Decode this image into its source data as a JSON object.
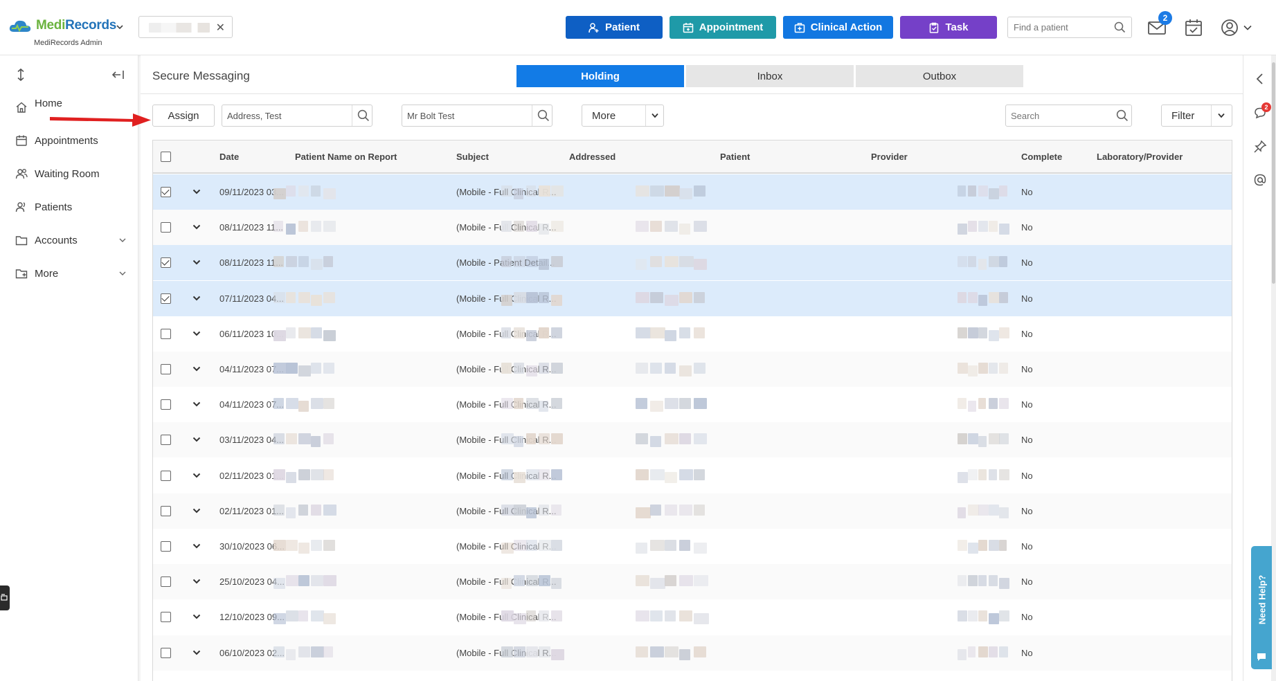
{
  "header": {
    "logo_part1": "Medi",
    "logo_part2": "Records",
    "subtitle": "MediRecords Admin",
    "buttons": [
      {
        "label": "Patient",
        "color": "#0e5fc4"
      },
      {
        "label": "Appointment",
        "color": "#1f9aa8"
      },
      {
        "label": "Clinical Action",
        "color": "#1277e1"
      },
      {
        "label": "Task",
        "color": "#7540c8"
      }
    ],
    "find_placeholder": "Find a patient",
    "message_badge": "2"
  },
  "sidebar": {
    "items": [
      {
        "label": "Home",
        "icon": "home-icon"
      },
      {
        "label": "Appointments",
        "icon": "calendar-icon"
      },
      {
        "label": "Waiting Room",
        "icon": "users-icon"
      },
      {
        "label": "Patients",
        "icon": "patients-icon"
      },
      {
        "label": "Accounts",
        "icon": "folder-icon"
      },
      {
        "label": "More",
        "icon": "folder-plus-icon"
      }
    ]
  },
  "main": {
    "title": "Secure Messaging",
    "tabs": [
      {
        "label": "Holding",
        "active": true
      },
      {
        "label": "Inbox",
        "active": false
      },
      {
        "label": "Outbox",
        "active": false
      }
    ],
    "toolbar": {
      "assign_label": "Assign",
      "address_value": "Address, Test",
      "patient_value": "Mr Bolt Test",
      "more_label": "More",
      "search_placeholder": "Search",
      "filter_label": "Filter"
    },
    "table": {
      "columns": [
        "Date",
        "Patient Name on Report",
        "Subject",
        "Addressed",
        "Patient",
        "Provider",
        "Complete",
        "Laboratory/Provider"
      ],
      "rows": [
        {
          "date": "09/11/2023 03...",
          "subject": "(Mobile - Full Clinical R...",
          "complete": "No",
          "checked": true
        },
        {
          "date": "08/11/2023 11...",
          "subject": "(Mobile - Full Clinical R...",
          "complete": "No",
          "checked": false
        },
        {
          "date": "08/11/2023 11...",
          "subject": "(Mobile - Patient Detail...",
          "complete": "No",
          "checked": true
        },
        {
          "date": "07/11/2023 04...",
          "subject": "(Mobile - Full Clinical R...",
          "complete": "No",
          "checked": true
        },
        {
          "date": "06/11/2023 10...",
          "subject": "(Mobile - Full Clinical R...",
          "complete": "No",
          "checked": false
        },
        {
          "date": "04/11/2023 07...",
          "subject": "(Mobile - Full Clinical R...",
          "complete": "No",
          "checked": false
        },
        {
          "date": "04/11/2023 07...",
          "subject": "(Mobile - Full Clinical R...",
          "complete": "No",
          "checked": false
        },
        {
          "date": "03/11/2023 04...",
          "subject": "(Mobile - Full Clinical R...",
          "complete": "No",
          "checked": false
        },
        {
          "date": "02/11/2023 01...",
          "subject": "(Mobile - Full Clinical R...",
          "complete": "No",
          "checked": false
        },
        {
          "date": "02/11/2023 01...",
          "subject": "(Mobile - Full Clinical R...",
          "complete": "No",
          "checked": false
        },
        {
          "date": "30/10/2023 06...",
          "subject": "(Mobile - Full Clinical R...",
          "complete": "No",
          "checked": false
        },
        {
          "date": "25/10/2023 04...",
          "subject": "(Mobile - Full Clinical R...",
          "complete": "No",
          "checked": false
        },
        {
          "date": "12/10/2023 09...",
          "subject": "(Mobile - Full Clinical R...",
          "complete": "No",
          "checked": false
        },
        {
          "date": "06/10/2023 02...",
          "subject": "(Mobile - Full Clinical R...",
          "complete": "No",
          "checked": false
        }
      ]
    }
  },
  "right_rail": {
    "chat_badge": "2",
    "help_label": "Need Help?"
  },
  "colors": {
    "accent": "#127be6",
    "selected_row": "#dcebfb",
    "annotation_arrow": "#e02020"
  }
}
